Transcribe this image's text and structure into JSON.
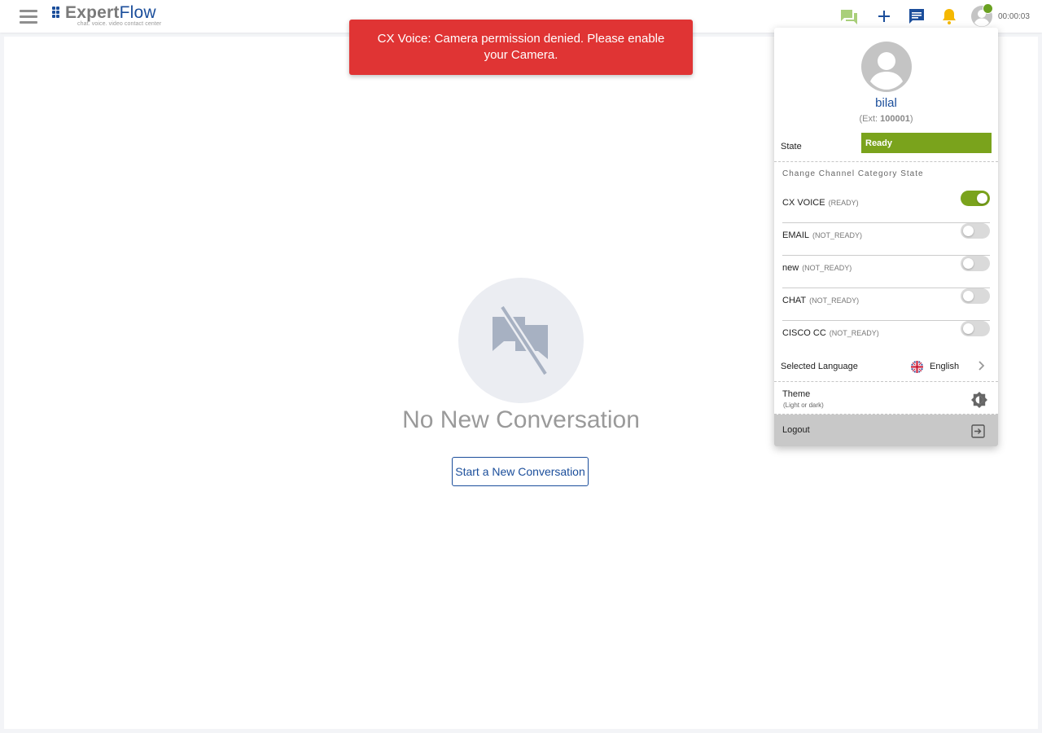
{
  "brand": {
    "name_part1": "Expert",
    "name_part2": "Flow",
    "tagline": "chat. voice. video contact center",
    "color": "#1b4e9b"
  },
  "header": {
    "icons": [
      "menu-icon",
      "conversations-icon",
      "add-icon",
      "chat-icon",
      "bell-icon",
      "user-avatar-icon"
    ],
    "timer": "00:00:03",
    "status_color": "#6aa121"
  },
  "toast": {
    "message": "CX Voice: Camera permission denied. Please enable your Camera.",
    "color": "#e03434"
  },
  "main": {
    "empty_title": "No New Conversation",
    "start_button": "Start a New Conversation"
  },
  "profile": {
    "name": "bilal",
    "ext_prefix": "(Ext:",
    "ext_number": "100001",
    "ext_suffix": ")",
    "state_label": "State",
    "state_value": "Ready",
    "state_color": "#7aa31c",
    "channels_title": "Change Channel Category State",
    "channels": [
      {
        "name": "CX VOICE",
        "status": "(READY)",
        "enabled": true
      },
      {
        "name": "EMAIL",
        "status": "(NOT_READY)",
        "enabled": false
      },
      {
        "name": "new",
        "status": "(NOT_READY)",
        "enabled": false
      },
      {
        "name": "CHAT",
        "status": "(NOT_READY)",
        "enabled": false
      },
      {
        "name": "CISCO CC",
        "status": "(NOT_READY)",
        "enabled": false
      }
    ],
    "language_label": "Selected Language",
    "language_value": "English",
    "theme_label": "Theme",
    "theme_sub": "(Light or dark)",
    "logout_label": "Logout"
  }
}
